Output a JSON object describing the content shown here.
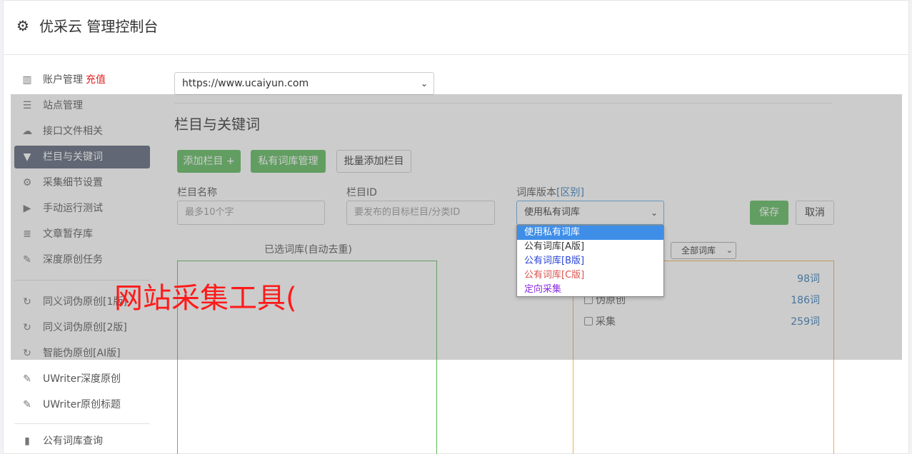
{
  "header": {
    "icon": "gear-icon",
    "title": "优采云 管理控制台"
  },
  "sidebar": {
    "items": [
      {
        "label": "账户管理",
        "extra": "充值",
        "icon": "bar-chart-icon"
      },
      {
        "label": "站点管理",
        "icon": "server-icon"
      },
      {
        "label": "接口文件相关",
        "icon": "cloud-upload-icon"
      },
      {
        "label": "栏目与关键词",
        "icon": "filter-icon"
      },
      {
        "label": "采集细节设置",
        "icon": "cogs-icon"
      },
      {
        "label": "手动运行测试",
        "icon": "play-circle-icon"
      },
      {
        "label": "文章暂存库",
        "icon": "database-icon"
      },
      {
        "label": "深度原创任务",
        "icon": "edit-icon"
      },
      {
        "label": "同义词伪原创[1版]",
        "icon": "refresh-icon"
      },
      {
        "label": "同义词伪原创[2版]",
        "icon": "refresh-icon"
      },
      {
        "label": "智能伪原创[AI版]",
        "icon": "refresh-icon"
      },
      {
        "label": "UWriter深度原创",
        "icon": "edit-icon"
      },
      {
        "label": "UWriter原创标题",
        "icon": "edit-icon"
      },
      {
        "label": "公有词库查询",
        "icon": "book-icon"
      }
    ],
    "active_color": "#5b6579"
  },
  "site_select": {
    "value": "https://www.ucaiyun.com"
  },
  "section": {
    "title": "栏目与关键词"
  },
  "buttons": {
    "add_column": "添加栏目 +",
    "private_lib": "私有词库管理",
    "batch_add": "批量添加栏目",
    "save": "保存",
    "cancel": "取消"
  },
  "form": {
    "column_name_label": "栏目名称",
    "column_name_placeholder": "最多10个字",
    "column_id_label": "栏目ID",
    "column_id_placeholder": "要发布的目标栏目/分类ID",
    "lib_version_label": "词库版本",
    "lib_version_link": "[区别]",
    "lib_version_value": "使用私有词库"
  },
  "dropdown": {
    "options": [
      "使用私有词库",
      "公有词库[A版]",
      "公有词库[B版]",
      "公有词库[C版]",
      "定向采集"
    ]
  },
  "selected_lib": {
    "caption": "已选词库(自动去重)"
  },
  "lib_filter": {
    "value": "全部词库"
  },
  "libs": [
    {
      "name": "",
      "count": "98词"
    },
    {
      "name": "伪原创",
      "count": "186词"
    },
    {
      "name": "采集",
      "count": "259词"
    }
  ],
  "watermark": "网站采集工具(",
  "colors": {
    "accent_green": "#5cb85c",
    "border_orange": "#f0ad4e",
    "link_blue": "#337ab7",
    "recharge_red": "#e02020"
  }
}
